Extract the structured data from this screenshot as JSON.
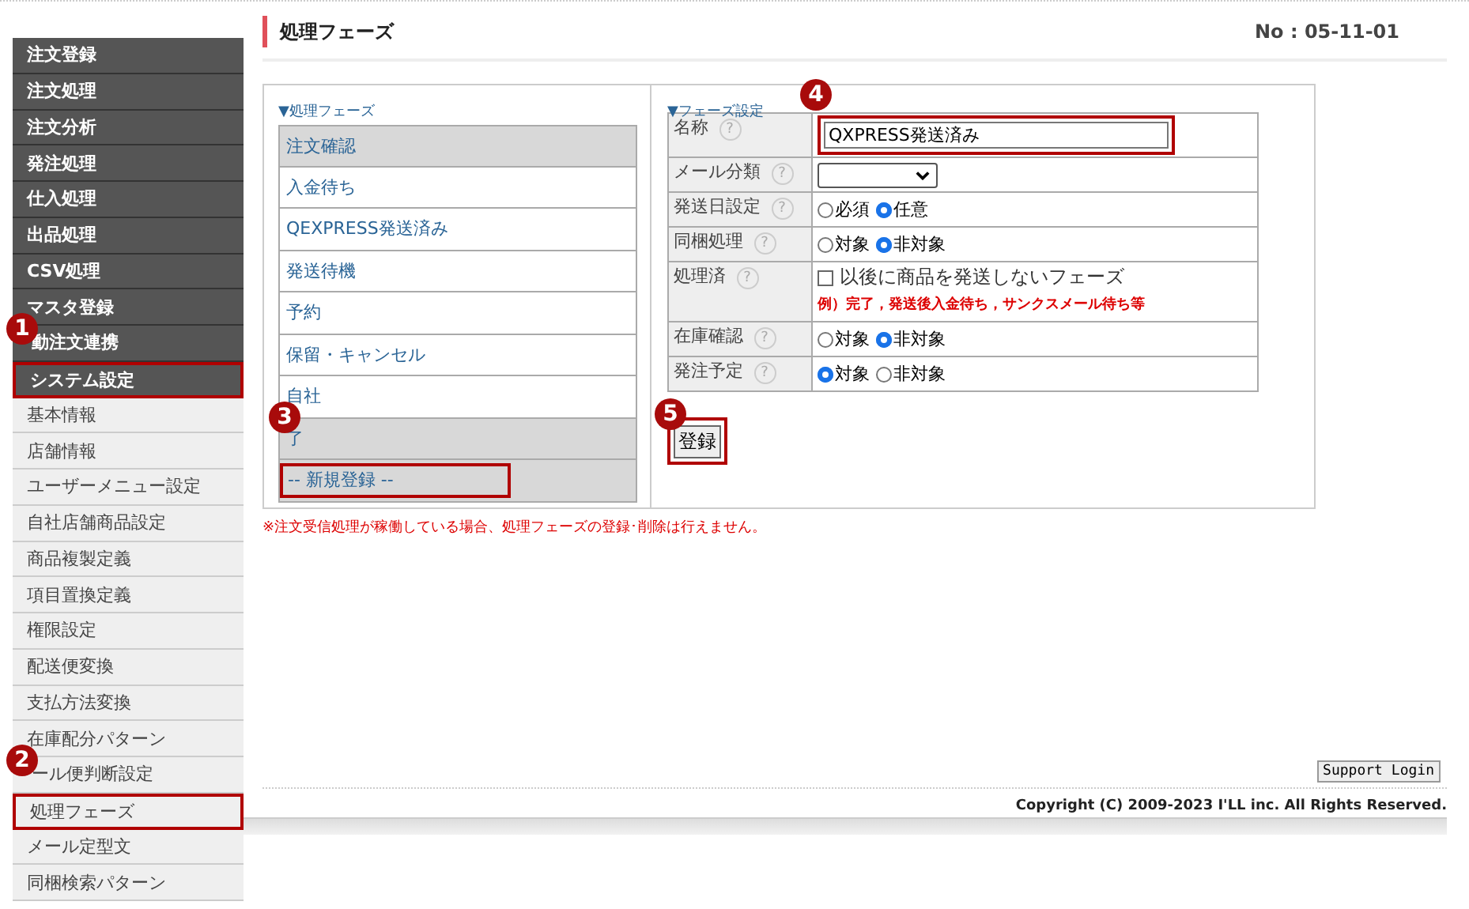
{
  "sidebar": {
    "items": [
      {
        "label": "注文登録",
        "kind": "main",
        "highlighted": false
      },
      {
        "label": "注文処理",
        "kind": "main",
        "highlighted": false
      },
      {
        "label": "注文分析",
        "kind": "main",
        "highlighted": false
      },
      {
        "label": "発注処理",
        "kind": "main",
        "highlighted": false
      },
      {
        "label": "仕入処理",
        "kind": "main",
        "highlighted": false
      },
      {
        "label": "出品処理",
        "kind": "main",
        "highlighted": false
      },
      {
        "label": "CSV処理",
        "kind": "main",
        "highlighted": false
      },
      {
        "label": "マスタ登録",
        "kind": "main",
        "highlighted": false
      },
      {
        "label": "動注文連携",
        "kind": "main",
        "highlighted": false,
        "badge": "1"
      },
      {
        "label": "システム設定",
        "kind": "main",
        "highlighted": true
      },
      {
        "label": "基本情報",
        "kind": "sub",
        "highlighted": false
      },
      {
        "label": "店舗情報",
        "kind": "sub",
        "highlighted": false
      },
      {
        "label": "ユーザーメニュー設定",
        "kind": "sub",
        "highlighted": false
      },
      {
        "label": "自社店舗商品設定",
        "kind": "sub",
        "highlighted": false
      },
      {
        "label": "商品複製定義",
        "kind": "sub",
        "highlighted": false
      },
      {
        "label": "項目置換定義",
        "kind": "sub",
        "highlighted": false
      },
      {
        "label": "権限設定",
        "kind": "sub",
        "highlighted": false
      },
      {
        "label": "配送便変換",
        "kind": "sub",
        "highlighted": false
      },
      {
        "label": "支払方法変換",
        "kind": "sub",
        "highlighted": false
      },
      {
        "label": "在庫配分パターン",
        "kind": "sub",
        "highlighted": false
      },
      {
        "label": "ール便判断設定",
        "kind": "sub",
        "highlighted": false,
        "badge": "2"
      },
      {
        "label": "処理フェーズ",
        "kind": "sub",
        "highlighted": true
      },
      {
        "label": "メール定型文",
        "kind": "sub",
        "highlighted": false
      },
      {
        "label": "同梱検索パターン",
        "kind": "sub",
        "highlighted": false
      }
    ]
  },
  "page": {
    "title": "処理フェーズ",
    "number": "No : 05-11-01"
  },
  "phase_list": {
    "heading": "▼処理フェーズ",
    "items": [
      {
        "label": "注文確認",
        "disabled": true,
        "highlighted": false
      },
      {
        "label": "入金待ち",
        "disabled": false,
        "highlighted": false
      },
      {
        "label": "QEXPRESS発送済み",
        "disabled": false,
        "highlighted": false
      },
      {
        "label": "発送待機",
        "disabled": false,
        "highlighted": false
      },
      {
        "label": "予約",
        "disabled": false,
        "highlighted": false
      },
      {
        "label": "保留・キャンセル",
        "disabled": false,
        "highlighted": false
      },
      {
        "label": "自社",
        "disabled": false,
        "highlighted": false
      },
      {
        "label": "了",
        "disabled": true,
        "highlighted": false,
        "badge": "3"
      },
      {
        "label": "-- 新規登録 --",
        "disabled": true,
        "highlighted": true
      }
    ]
  },
  "settings": {
    "heading": "▼フェーズ設定",
    "badge": "4",
    "help": "?",
    "rows": [
      {
        "label": "名称",
        "kind": "text",
        "value": "QXPRESS発送済み",
        "highlighted": true
      },
      {
        "label": "メール分類",
        "kind": "select"
      },
      {
        "label": "発送日設定",
        "kind": "radio",
        "options": [
          {
            "label": "必須",
            "selected": false
          },
          {
            "label": "任意",
            "selected": true
          }
        ]
      },
      {
        "label": "同梱処理",
        "kind": "radio",
        "options": [
          {
            "label": "対象",
            "selected": false
          },
          {
            "label": "非対象",
            "selected": true
          }
        ]
      },
      {
        "label": "処理済",
        "kind": "checkbox",
        "checked": false,
        "text": "以後に商品を発送しないフェーズ",
        "note": "例）完了，発送後入金待ち，サンクスメール待ち等"
      },
      {
        "label": "在庫確認",
        "kind": "radio",
        "options": [
          {
            "label": "対象",
            "selected": false
          },
          {
            "label": "非対象",
            "selected": true
          }
        ]
      },
      {
        "label": "発注予定",
        "kind": "radio",
        "options": [
          {
            "label": "対象",
            "selected": true
          },
          {
            "label": "非対象",
            "selected": false
          }
        ]
      }
    ],
    "submit": {
      "label": "登録",
      "badge": "5",
      "highlighted": true
    }
  },
  "warning": "※注文受信処理が稼働している場合、処理フェーズの登録･削除は行えません。",
  "support_button": "Support Login",
  "copyright": "Copyright (C) 2009-2023 I'LL inc. All Rights Reserved."
}
